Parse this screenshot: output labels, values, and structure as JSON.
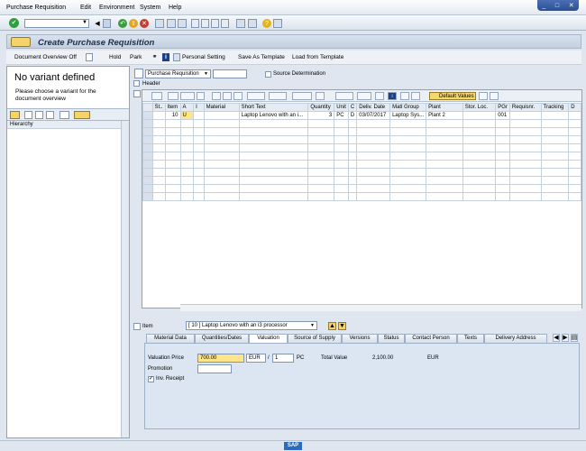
{
  "menu": {
    "items": [
      "Purchase Requisition",
      "Edit",
      "Environment",
      "System",
      "Help"
    ]
  },
  "window": {
    "min": "_",
    "max": "□",
    "close": "✕"
  },
  "title": "Create Purchase Requisition",
  "app_toolbar": {
    "doc_overview": "Document Overview Off",
    "hold": "Hold",
    "park": "Park",
    "personal_setting": "Personal Setting",
    "save_as_template": "Save As Template",
    "load_from_template": "Load from Template"
  },
  "left_panel": {
    "title": "No variant defined",
    "text": "Please choose a variant for the document overview",
    "hierarchy": "Hierarchy"
  },
  "header_area": {
    "doc_type": "Purchase Requisition",
    "source_determination": "Source Determination",
    "header_label": "Header"
  },
  "grid": {
    "default_values": "Default Values",
    "columns": [
      "St..",
      "Item",
      "A",
      "I",
      "Material",
      "Short Text",
      "Quantity",
      "Unit",
      "C",
      "Deliv. Date",
      "Matl Group",
      "Plant",
      "Stor. Loc.",
      "PGr",
      "Requisnr.",
      "Tracking",
      "D"
    ],
    "row": [
      "",
      "10",
      "U",
      "",
      "",
      "Laptop Lenovo with an i...",
      "3",
      "PC",
      "D",
      "03/07/2017",
      "Laptop Sys...",
      "Plant 2",
      "",
      "001",
      "",
      "",
      ""
    ]
  },
  "item_detail": {
    "label": "Item",
    "selected": "[ 10 ] Laptop Lenovo with an i3 processor",
    "tabs": [
      "Material Data",
      "Quantities/Dates",
      "Valuation",
      "Source of Supply",
      "Versions",
      "Status",
      "Contact Person",
      "Texts",
      "Delivery Address"
    ],
    "active_tab": "Valuation",
    "valuation_price_label": "Valuation Price",
    "valuation_price": "700.00",
    "currency": "EUR",
    "per_sep": "/",
    "per_value": "1",
    "per_unit": "PC",
    "total_value_label": "Total Value",
    "total_value": "2,100.00",
    "total_currency": "EUR",
    "promotion_label": "Promotion",
    "inv_receipt_label": "Inv. Receipt",
    "inv_receipt_checked": true
  },
  "status": {
    "logo": "SAP"
  }
}
